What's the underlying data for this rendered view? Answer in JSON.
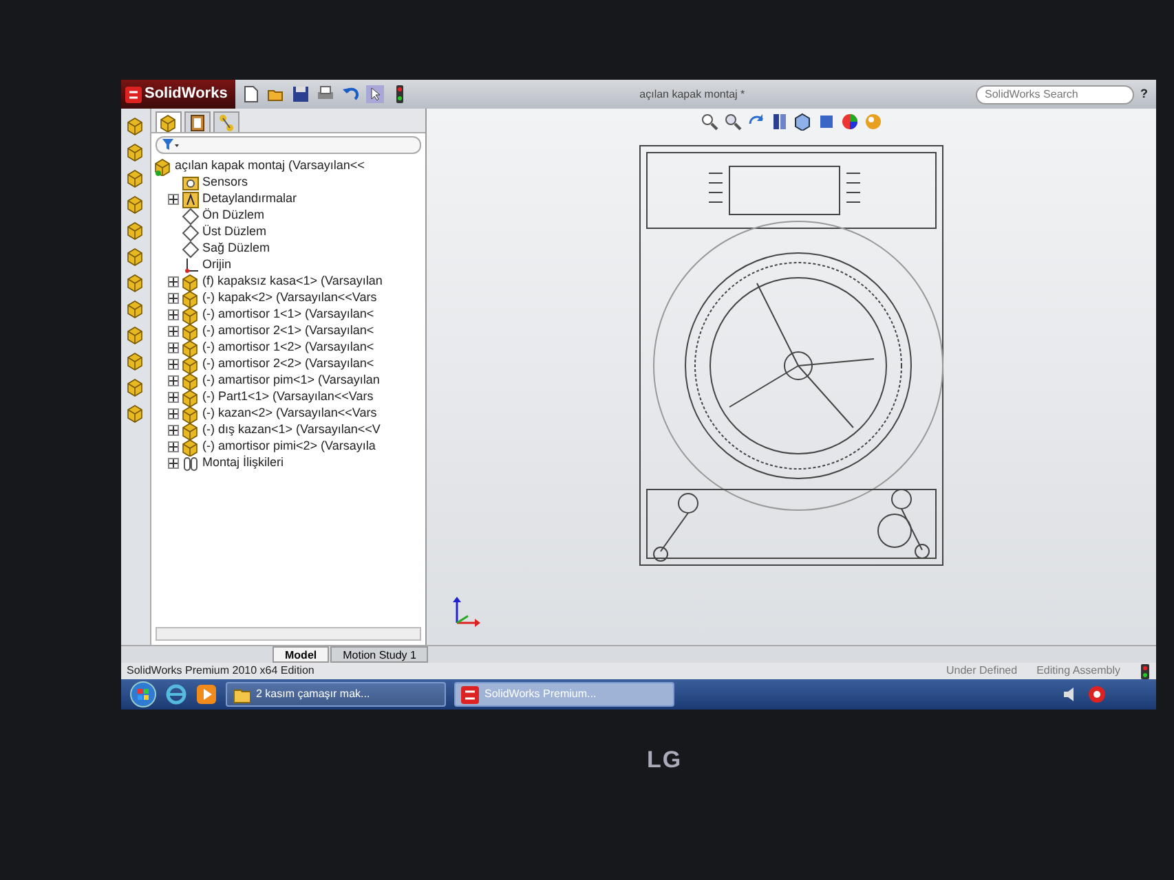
{
  "app": {
    "logo": "SolidWorks",
    "title": "açılan kapak montaj *",
    "search": {
      "placeholder": "SolidWorks Search"
    },
    "help": "?"
  },
  "panel_tabs": [
    {
      "kind": "feature",
      "selected": true
    },
    {
      "kind": "property",
      "selected": false
    },
    {
      "kind": "config",
      "selected": false
    }
  ],
  "tree": {
    "label": "açılan kapak montaj (Varsayılan<<",
    "kind": "assembly",
    "children": [
      {
        "label": "Sensors",
        "kind": "sensor"
      },
      {
        "label": "Detaylandırmalar",
        "kind": "annotation",
        "expanded": false
      },
      {
        "label": "Ön Düzlem",
        "kind": "plane"
      },
      {
        "label": "Üst Düzlem",
        "kind": "plane"
      },
      {
        "label": "Sağ Düzlem",
        "kind": "plane"
      },
      {
        "label": "Orijin",
        "kind": "origin"
      },
      {
        "label": "(f) kapaksız kasa<1> (Varsayılan",
        "kind": "part",
        "expanded": false
      },
      {
        "label": "(-) kapak<2> (Varsayılan<<Vars",
        "kind": "part",
        "expanded": false
      },
      {
        "label": "(-) amortisor 1<1> (Varsayılan<",
        "kind": "part",
        "expanded": false
      },
      {
        "label": "(-) amortisor 2<1> (Varsayılan<",
        "kind": "part",
        "expanded": false
      },
      {
        "label": "(-) amortisor 1<2> (Varsayılan<",
        "kind": "part",
        "expanded": false
      },
      {
        "label": "(-) amortisor 2<2> (Varsayılan<",
        "kind": "part",
        "expanded": false
      },
      {
        "label": "(-) amartisor pim<1> (Varsayılan",
        "kind": "part",
        "expanded": false
      },
      {
        "label": "(-) Part1<1> (Varsayılan<<Vars",
        "kind": "part",
        "expanded": false
      },
      {
        "label": "(-) kazan<2> (Varsayılan<<Vars",
        "kind": "part",
        "expanded": false
      },
      {
        "label": "(-) dış kazan<1> (Varsayılan<<V",
        "kind": "part",
        "expanded": false
      },
      {
        "label": "(-) amortisor pimi<2> (Varsayıla",
        "kind": "part",
        "expanded": false
      },
      {
        "label": "Montaj İlişkileri",
        "kind": "mates",
        "expanded": false
      }
    ]
  },
  "bottom_tabs": [
    {
      "label": "Model",
      "selected": true
    },
    {
      "label": "Motion Study 1",
      "selected": false
    }
  ],
  "status_bar": {
    "edition": "SolidWorks Premium 2010 x64 Edition",
    "state": "Under Defined",
    "mode": "Editing Assembly"
  },
  "taskbar": {
    "buttons": [
      {
        "label": "2 kasım çamaşır mak...",
        "kind": "folder",
        "selected": false
      },
      {
        "label": "SolidWorks Premium...",
        "kind": "app",
        "selected": true
      }
    ]
  },
  "monitor": {
    "brand": "LG"
  }
}
